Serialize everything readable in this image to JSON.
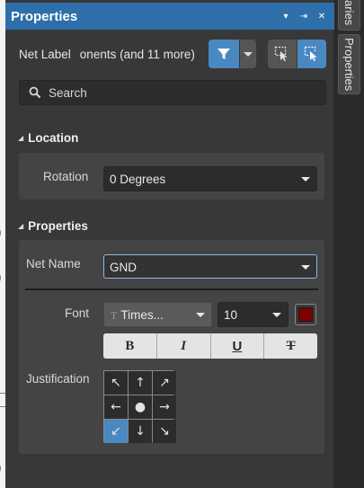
{
  "panel": {
    "title": "Properties",
    "title_buttons": [
      "▾",
      "⇥",
      "✕"
    ]
  },
  "filter": {
    "object_kind": "Net Label",
    "components_text": "onents (and 11 more)"
  },
  "search": {
    "placeholder": "Search"
  },
  "location": {
    "header": "Location",
    "rotation_label": "Rotation",
    "rotation_value": "0 Degrees"
  },
  "properties": {
    "header": "Properties",
    "net_name_label": "Net Name",
    "net_name_value": "GND",
    "font_label": "Font",
    "font_name": "Times...",
    "font_size": "10",
    "font_color": "#800000",
    "style_buttons": [
      "B",
      "I",
      "U",
      "T"
    ],
    "justification_label": "Justification",
    "justification_arrows": [
      "↖",
      "↑",
      "↗",
      "←",
      "●",
      "→",
      "↙",
      "↓",
      "↘"
    ],
    "justification_selected": 6
  },
  "side_tabs": [
    "aries",
    "Properties"
  ],
  "colors": {
    "accent": "#4a88c2",
    "title_bar": "#2f6fa9",
    "panel_bg": "#383838",
    "group_bg": "#444444"
  }
}
